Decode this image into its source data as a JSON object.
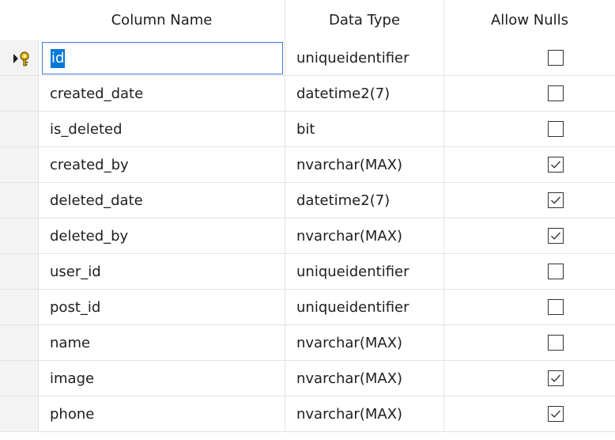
{
  "header": {
    "column_name": "Column Name",
    "data_type": "Data Type",
    "allow_nulls": "Allow Nulls"
  },
  "rows": [
    {
      "name": "id",
      "type": "uniqueidentifier",
      "nulls": false,
      "primary_key": true
    },
    {
      "name": "created_date",
      "type": "datetime2(7)",
      "nulls": false
    },
    {
      "name": "is_deleted",
      "type": "bit",
      "nulls": false
    },
    {
      "name": "created_by",
      "type": "nvarchar(MAX)",
      "nulls": true
    },
    {
      "name": "deleted_date",
      "type": "datetime2(7)",
      "nulls": true
    },
    {
      "name": "deleted_by",
      "type": "nvarchar(MAX)",
      "nulls": true
    },
    {
      "name": "user_id",
      "type": "uniqueidentifier",
      "nulls": false
    },
    {
      "name": "post_id",
      "type": "uniqueidentifier",
      "nulls": false
    },
    {
      "name": "name",
      "type": "nvarchar(MAX)",
      "nulls": false
    },
    {
      "name": "image",
      "type": "nvarchar(MAX)",
      "nulls": true
    },
    {
      "name": "phone",
      "type": "nvarchar(MAX)",
      "nulls": true
    }
  ],
  "icons": {
    "current_row": "current-row-arrow-icon",
    "primary_key": "primary-key-icon",
    "checkbox_checked": "checkmark-icon"
  },
  "colors": {
    "selection": "#0078d7",
    "edit_border": "#3b7dd8",
    "gridline": "#e3e3e3"
  }
}
